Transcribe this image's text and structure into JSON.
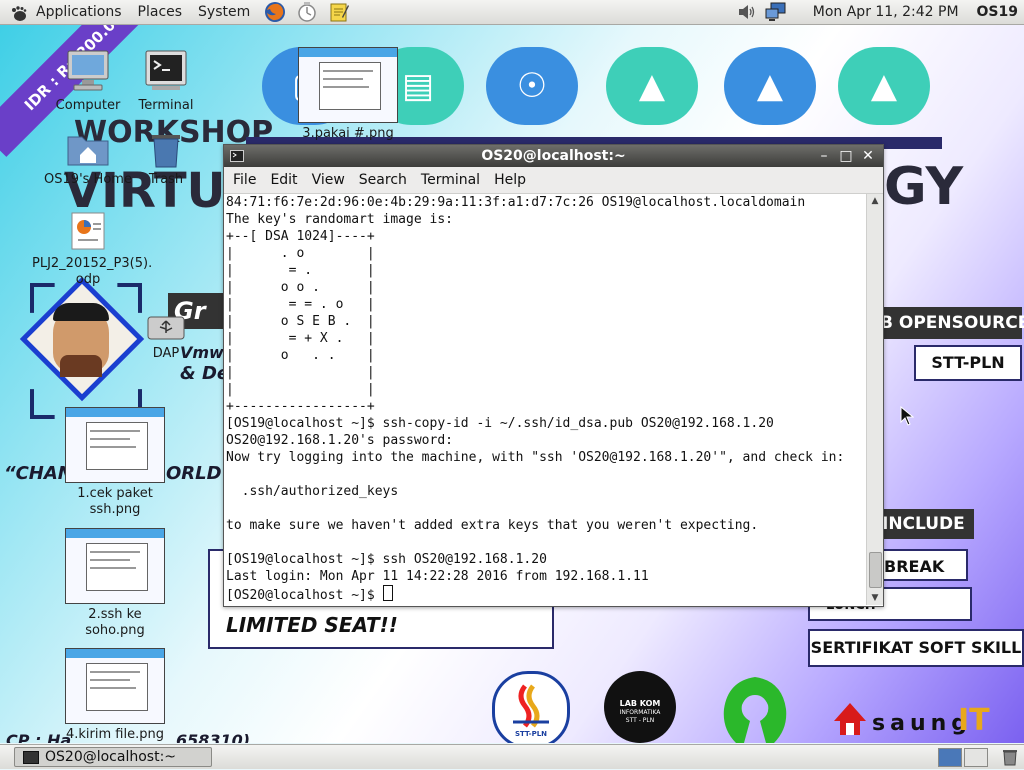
{
  "top_panel": {
    "menus": [
      "Applications",
      "Places",
      "System"
    ],
    "launchers": [
      "firefox-icon",
      "network-manager-icon",
      "text-editor-icon"
    ],
    "clock": "Mon Apr 11,  2:42 PM",
    "hostname": "OS19"
  },
  "wallpaper": {
    "ribbon": "IDR : Rp 200.0",
    "workshop": "WORKSHOP",
    "virtu": "VIRTU",
    "gy": "GY",
    "gr": "Gr",
    "vmw": "Vmw",
    "de": "& De",
    "chan": "“CHAN",
    "orld": "ORLD",
    "opensource": "B OPENSOURCE",
    "sttpln": "STT-PLN",
    "include": "INCLUDE",
    "break": "BREAK",
    "lunch": "LUNCH",
    "sertifikat": "SERTIFIKAT SOFT SKILL",
    "limited": "LIMITED SEAT!!",
    "cp": "CP : Ha",
    "cp_tail": "658310)",
    "logo_stt": "STT-PLN",
    "logo_labkom": "LAB KOM",
    "logo_labkom_sub": "INFORMATIKA",
    "logo_labkom_sub2": "STT - PLN",
    "saung": "saung",
    "saung_it": "IT"
  },
  "desktop_icons": [
    {
      "label": "Computer"
    },
    {
      "label": "Terminal"
    },
    {
      "label": "3.pakai #.png"
    },
    {
      "label": "OS19's Home"
    },
    {
      "label": "Trash"
    },
    {
      "label": "PLJ2_20152_P3(5).\nodp"
    },
    {
      "label": "DAP"
    },
    {
      "label": "1.cek paket ssh.png"
    },
    {
      "label": "2.ssh ke soho.png"
    },
    {
      "label": "4.kirim file.png"
    }
  ],
  "terminal": {
    "title": "OS20@localhost:~",
    "menu": [
      "File",
      "Edit",
      "View",
      "Search",
      "Terminal",
      "Help"
    ],
    "lines": [
      "84:71:f6:7e:2d:96:0e:4b:29:9a:11:3f:a1:d7:7c:26 OS19@localhost.localdomain",
      "The key's randomart image is:",
      "+--[ DSA 1024]----+",
      "|      . o        |",
      "|       = .       |",
      "|      o o .      |",
      "|       = = . o   |",
      "|      o S E B .  |",
      "|       = + X .   |",
      "|      o   . .    |",
      "|                 |",
      "|                 |",
      "+-----------------+",
      "[OS19@localhost ~]$ ssh-copy-id -i ~/.ssh/id_dsa.pub OS20@192.168.1.20",
      "OS20@192.168.1.20's password:",
      "Now try logging into the machine, with \"ssh 'OS20@192.168.1.20'\", and check in:",
      "",
      "  .ssh/authorized_keys",
      "",
      "to make sure we haven't added extra keys that you weren't expecting.",
      "",
      "[OS19@localhost ~]$ ssh OS20@192.168.1.20",
      "Last login: Mon Apr 11 14:22:28 2016 from 192.168.1.11"
    ],
    "prompt": "[OS20@localhost ~]$ "
  },
  "bottom_panel": {
    "task_label": "OS20@localhost:~"
  }
}
